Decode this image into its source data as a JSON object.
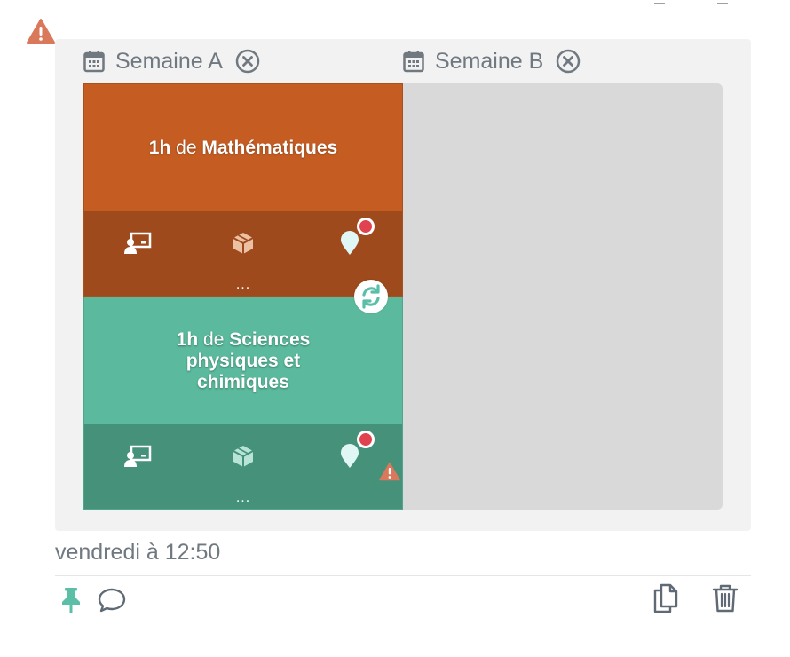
{
  "weeks": [
    {
      "label": "Semaine A"
    },
    {
      "label": "Semaine B"
    }
  ],
  "cards": [
    {
      "hours": "1h",
      "connector": "de",
      "subject": "Mathématiques",
      "more": "...",
      "color": "#c55d23",
      "footer_color": "#9e4a1c"
    },
    {
      "hours": "1h",
      "connector": "de",
      "subject_lines": [
        "Sciences",
        "physiques et",
        "chimiques"
      ],
      "more": "...",
      "color": "#5bba9d",
      "footer_color": "#45917a"
    }
  ],
  "timestamp": "vendredi à 12:50",
  "icons": {
    "warning": "warning-triangle-icon",
    "calendar": "calendar-icon",
    "remove": "close-circle-icon",
    "teacher": "teacher-board-icon",
    "room": "box-icon",
    "location": "location-pin-icon",
    "swap": "swap-icon",
    "pin": "pin-icon",
    "comment": "comment-icon",
    "copy": "copy-icon",
    "delete": "trash-icon"
  },
  "colors": {
    "accent": "#5bbfa8",
    "warning": "#d9785a",
    "alert": "#e0424f",
    "muted_text": "#707880"
  }
}
